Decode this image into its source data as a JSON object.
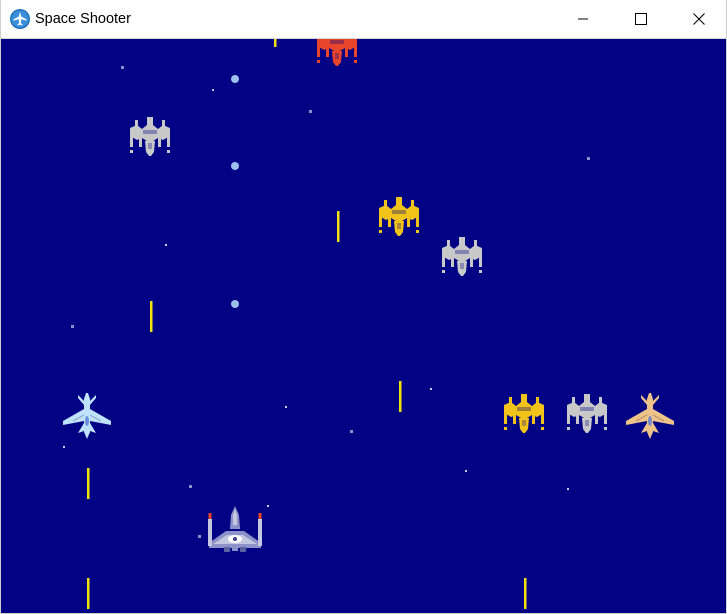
{
  "window": {
    "title": "Space Shooter",
    "app_icon": "airplane-app-icon",
    "controls": [
      "minimize-icon",
      "maximize-icon",
      "close-icon"
    ]
  },
  "game": {
    "background_color": "#020285",
    "bullet_color": "#f2e20a",
    "player_ship": {
      "type": "fighter",
      "color": "#c3c8e0"
    },
    "enemy_colors": {
      "red": "#e8452a",
      "silver": "#c8c8c8",
      "gold": "#f2c318",
      "light_blue": "#bfe2ff",
      "tan": "#eec38a"
    },
    "enemies": [
      {
        "kind": "drone",
        "color": "red"
      },
      {
        "kind": "drone",
        "color": "silver"
      },
      {
        "kind": "drone",
        "color": "gold"
      },
      {
        "kind": "drone",
        "color": "silver"
      },
      {
        "kind": "jet",
        "color": "light_blue"
      },
      {
        "kind": "drone",
        "color": "gold"
      },
      {
        "kind": "drone",
        "color": "silver"
      },
      {
        "kind": "jet",
        "color": "tan"
      }
    ]
  }
}
